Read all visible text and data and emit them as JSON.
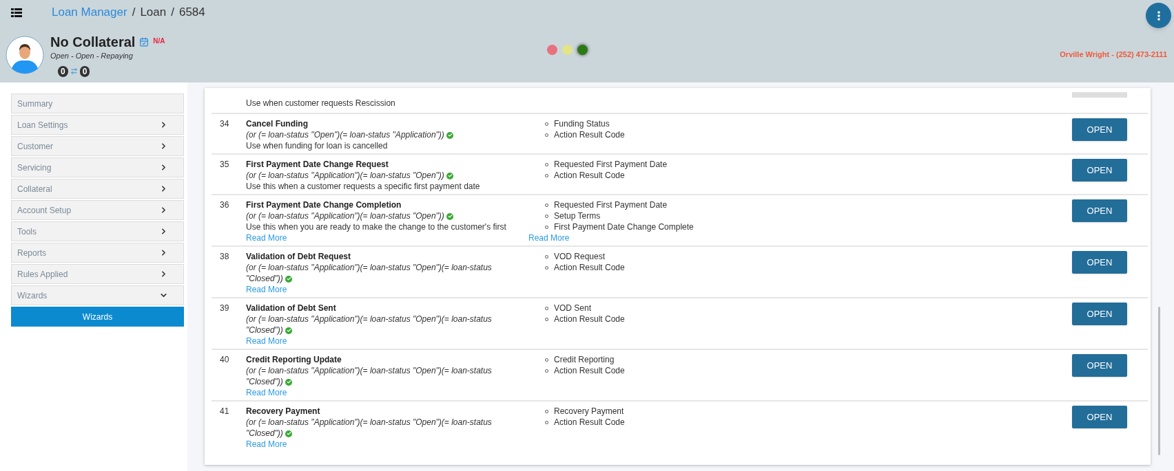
{
  "header": {
    "breadcrumb": [
      {
        "label": "Loan Manager",
        "link": true
      },
      {
        "label": "Loan",
        "link": false
      },
      {
        "label": "6584",
        "link": false
      }
    ],
    "breadcrumb_separator": "/",
    "title": "No Collateral",
    "badge": "N/A",
    "subtitle": "Open - Open - Repaying",
    "counters": [
      "0",
      "0"
    ],
    "status_lights": [
      {
        "color": "#e8717f",
        "active": false
      },
      {
        "color": "#e3e388",
        "active": false
      },
      {
        "color": "#2b7a16",
        "active": true
      }
    ],
    "contact": "Orville Wright - (252) 473-2111"
  },
  "sidebar": {
    "items": [
      {
        "label": "Summary",
        "kind": "link"
      },
      {
        "label": "Loan Settings",
        "kind": "group",
        "expanded": false
      },
      {
        "label": "Customer",
        "kind": "group",
        "expanded": false
      },
      {
        "label": "Servicing",
        "kind": "group",
        "expanded": false
      },
      {
        "label": "Collateral",
        "kind": "group",
        "expanded": false
      },
      {
        "label": "Account Setup",
        "kind": "group",
        "expanded": false
      },
      {
        "label": "Tools",
        "kind": "group",
        "expanded": false
      },
      {
        "label": "Reports",
        "kind": "group",
        "expanded": false
      },
      {
        "label": "Rules Applied",
        "kind": "group",
        "expanded": false
      },
      {
        "label": "Wizards",
        "kind": "group",
        "expanded": true,
        "children": [
          {
            "label": "Wizards",
            "selected": true
          }
        ]
      }
    ]
  },
  "wizards": {
    "partial_row": {
      "description": "Use when customer requests Rescission"
    },
    "rows": [
      {
        "number": "34",
        "title": "Cancel Funding",
        "condition": "(or (= loan-status \"Open\")(= loan-status \"Application\"))",
        "condition_met": true,
        "description": "Use when funding for loan is cancelled",
        "fields": [
          "Funding Status",
          "Action Result Code"
        ],
        "button": "OPEN"
      },
      {
        "number": "35",
        "title": "First Payment Date Change Request",
        "condition": "(or (= loan-status \"Application\")(= loan-status \"Open\"))",
        "condition_met": true,
        "description": "Use this when a customer requests a specific first payment date",
        "fields": [
          "Requested First Payment Date",
          "Action Result Code"
        ],
        "button": "OPEN"
      },
      {
        "number": "36",
        "title": "First Payment Date Change Completion",
        "condition": "(or (= loan-status \"Application\")(= loan-status \"Open\"))",
        "condition_met": true,
        "description": "Use this when you are ready to make the change to the customer's first",
        "read_more": "Read More",
        "fields": [
          "Requested First Payment Date",
          "Setup Terms",
          "First Payment Date Change Complete"
        ],
        "fields_read_more": "Read More",
        "button": "OPEN"
      },
      {
        "number": "38",
        "title": "Validation of Debt Request",
        "condition": "(or (= loan-status \"Application\")(= loan-status \"Open\")(= loan-status \"Closed\"))",
        "condition_met": true,
        "read_more": "Read More",
        "fields": [
          "VOD Request",
          "Action Result Code"
        ],
        "button": "OPEN"
      },
      {
        "number": "39",
        "title": "Validation of Debt Sent",
        "condition": "(or (= loan-status \"Application\")(= loan-status \"Open\")(= loan-status \"Closed\"))",
        "condition_met": true,
        "read_more": "Read More",
        "fields": [
          "VOD Sent",
          "Action Result Code"
        ],
        "button": "OPEN"
      },
      {
        "number": "40",
        "title": "Credit Reporting Update",
        "condition": "(or (= loan-status \"Application\")(= loan-status \"Open\")(= loan-status \"Closed\"))",
        "condition_met": true,
        "read_more": "Read More",
        "fields": [
          "Credit Reporting",
          "Action Result Code"
        ],
        "button": "OPEN"
      },
      {
        "number": "41",
        "title": "Recovery Payment",
        "condition": "(or (= loan-status \"Application\")(= loan-status \"Open\")(= loan-status \"Closed\"))",
        "condition_met": true,
        "read_more": "Read More",
        "fields": [
          "Recovery Payment",
          "Action Result Code"
        ],
        "button": "OPEN"
      }
    ]
  }
}
